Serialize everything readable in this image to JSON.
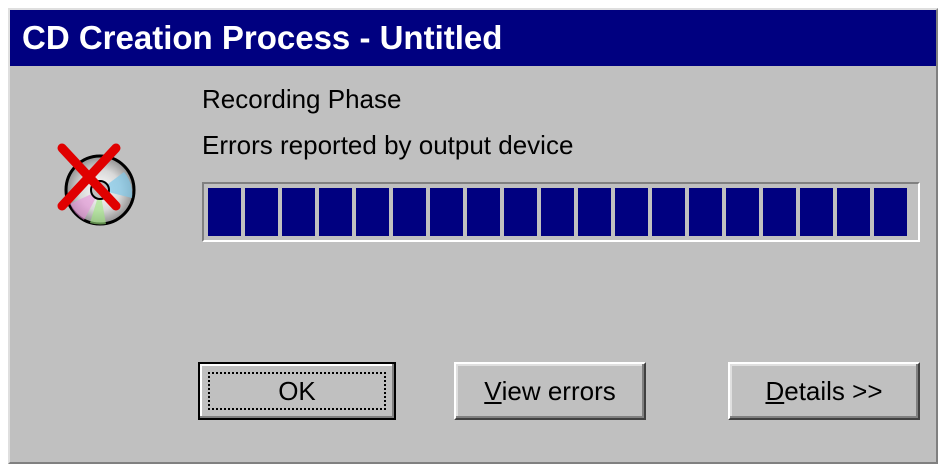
{
  "window": {
    "title": "CD Creation Process - Untitled"
  },
  "content": {
    "phase_text": "Recording Phase",
    "status_text": "Errors reported by output device",
    "icon": "cd-error-icon",
    "progress": {
      "percent": 100,
      "color": "#000080"
    }
  },
  "buttons": {
    "ok_label": "OK",
    "view_errors": {
      "mnemonic": "V",
      "rest": "iew errors"
    },
    "details": {
      "mnemonic": "D",
      "rest": "etails >>"
    }
  },
  "colors": {
    "titlebar": "#000080",
    "face": "#c0c0c0",
    "error_x": "#e00000"
  }
}
